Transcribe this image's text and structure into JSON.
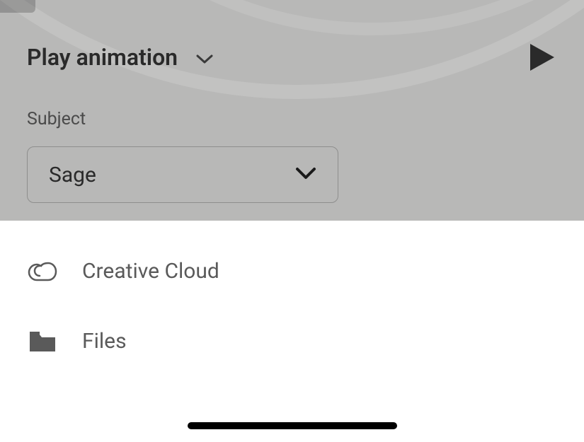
{
  "top": {
    "title": "Play animation",
    "subject_label": "Subject",
    "subject_value": "Sage"
  },
  "menu": {
    "items": [
      {
        "label": "Creative Cloud"
      },
      {
        "label": "Files"
      }
    ]
  }
}
